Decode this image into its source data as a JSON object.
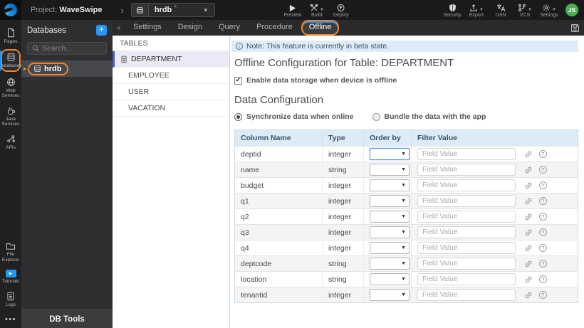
{
  "topbar": {
    "project_prefix": "Project:",
    "project_name": "WaveSwipe",
    "db_selector": {
      "value": "hrdb"
    },
    "actions": [
      {
        "label": "Preview"
      },
      {
        "label": "Build"
      },
      {
        "label": "Deploy"
      }
    ],
    "right_actions": [
      {
        "label": "Security"
      },
      {
        "label": "Export"
      },
      {
        "label": "I18N"
      },
      {
        "label": "VCS"
      },
      {
        "label": "Settings"
      }
    ],
    "avatar_initials": "JS"
  },
  "rail": {
    "items": [
      {
        "label": "Pages"
      },
      {
        "label": "Databases"
      },
      {
        "label": "Web Services"
      },
      {
        "label": "Java Services"
      },
      {
        "label": "APIs"
      },
      {
        "label": "File Explorer"
      },
      {
        "label": "Tutorials"
      },
      {
        "label": "Logs"
      }
    ],
    "more": "•••"
  },
  "db_panel": {
    "title": "Databases",
    "add_label": "+",
    "search_placeholder": "Search...",
    "items": [
      {
        "label": "hrdb"
      }
    ],
    "footer": "DB Tools"
  },
  "tabs": {
    "collapse": "«",
    "items": [
      {
        "label": "Settings"
      },
      {
        "label": "Design"
      },
      {
        "label": "Query"
      },
      {
        "label": "Procedure"
      },
      {
        "label": "Offline"
      }
    ],
    "active": "Offline"
  },
  "tables_panel": {
    "title": "TABLES",
    "items": [
      {
        "label": "DEPARTMENT"
      },
      {
        "label": "EMPLOYEE"
      },
      {
        "label": "USER"
      },
      {
        "label": "VACATION"
      }
    ],
    "selected": "DEPARTMENT"
  },
  "content": {
    "note": "Note: This feature is currently in beta state.",
    "title": "Offline Configuration for Table: DEPARTMENT",
    "enable_checkbox_label": "Enable data storage when device is offline",
    "enable_checkbox_checked": true,
    "section_title": "Data Configuration",
    "radio_options": [
      {
        "label": "Synchronize data when online",
        "checked": true
      },
      {
        "label": "Bundle the data with the app",
        "checked": false
      }
    ],
    "table": {
      "headers": [
        "Column Name",
        "Type",
        "Order by",
        "Filter Value"
      ],
      "field_placeholder": "Field Value",
      "rows": [
        {
          "name": "deptid",
          "type": "integer"
        },
        {
          "name": "name",
          "type": "string"
        },
        {
          "name": "budget",
          "type": "integer"
        },
        {
          "name": "q1",
          "type": "integer"
        },
        {
          "name": "q2",
          "type": "integer"
        },
        {
          "name": "q3",
          "type": "integer"
        },
        {
          "name": "q4",
          "type": "integer"
        },
        {
          "name": "deptcode",
          "type": "string"
        },
        {
          "name": "location",
          "type": "string"
        },
        {
          "name": "tenantid",
          "type": "integer"
        }
      ]
    }
  },
  "colors": {
    "accent_blue": "#2196f3",
    "annotation_orange": "#ee8434",
    "note_bg": "#dcecf8",
    "table_header_bg": "#dcebf6",
    "selected_item_bg": "#eae9f6",
    "avatar_green": "#4caf50"
  }
}
